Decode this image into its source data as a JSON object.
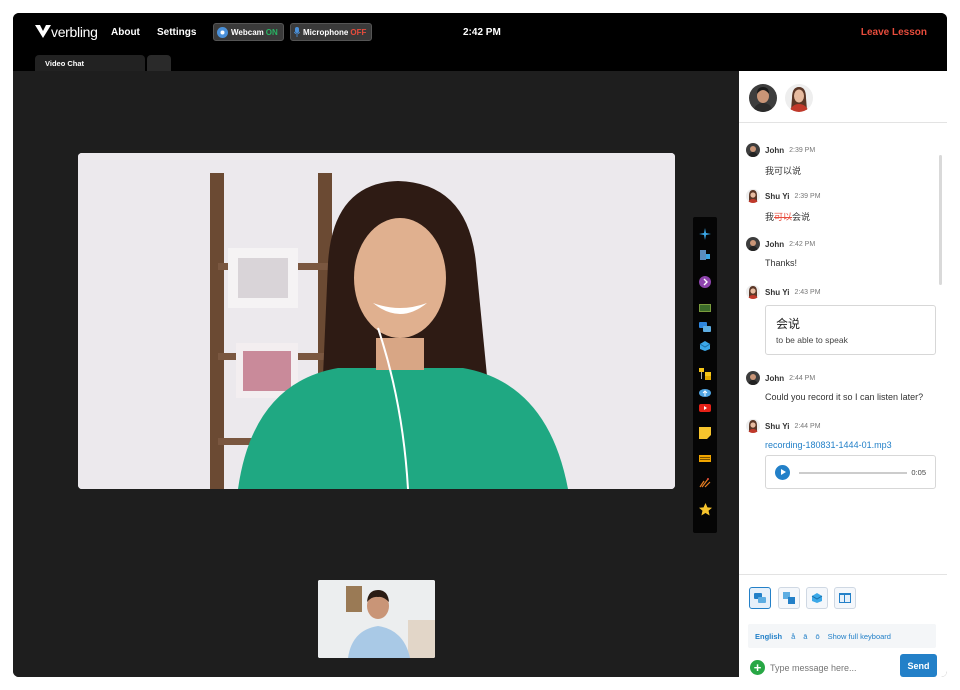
{
  "header": {
    "logo_text": "verbling",
    "nav": [
      "About",
      "Settings"
    ],
    "webcam": {
      "label": "Webcam",
      "state": "ON"
    },
    "microphone": {
      "label": "Microphone",
      "state": "OFF"
    },
    "clock": "2:42 PM",
    "leave_label": "Leave Lesson"
  },
  "tabs": [
    {
      "label": "Video Chat"
    },
    {
      "label": ""
    }
  ],
  "tools": [
    "sparkle-icon",
    "screenshare-icon",
    "arrow-next-icon",
    "film-icon",
    "chat-bubbles-icon",
    "cube-icon",
    "folders-icon",
    "cloud-upload-icon",
    "youtube-icon",
    "sticky-note-icon",
    "keyboard-icon",
    "fireworks-icon",
    "star-icon"
  ],
  "chat": {
    "messages": [
      {
        "name": "John",
        "time": "2:39 PM",
        "text": "我可以说"
      },
      {
        "name": "Shu Yi",
        "time": "2:39 PM",
        "text_prefix": "我",
        "text_struck": "可以",
        "text_suffix": "会说"
      },
      {
        "name": "John",
        "time": "2:42 PM",
        "text": "Thanks!"
      },
      {
        "name": "Shu Yi",
        "time": "2:43 PM",
        "card_title": "会说",
        "card_subtitle": "to be able to speak"
      },
      {
        "name": "John",
        "time": "2:44 PM",
        "text": "Could you record it so I can listen later?"
      },
      {
        "name": "Shu Yi",
        "time": "2:44 PM",
        "file": "recording-180831-1444-01.mp3",
        "duration": "0:05"
      }
    ]
  },
  "keyboard": {
    "language": "English",
    "chars": [
      "å",
      "ā",
      "ō"
    ],
    "full_label": "Show full keyboard"
  },
  "composer": {
    "placeholder": "Type message here...",
    "send_label": "Send"
  },
  "colors": {
    "accent": "#2380c8",
    "leave": "#e74c3c",
    "on": "#28b463",
    "off": "#e74c3c"
  }
}
